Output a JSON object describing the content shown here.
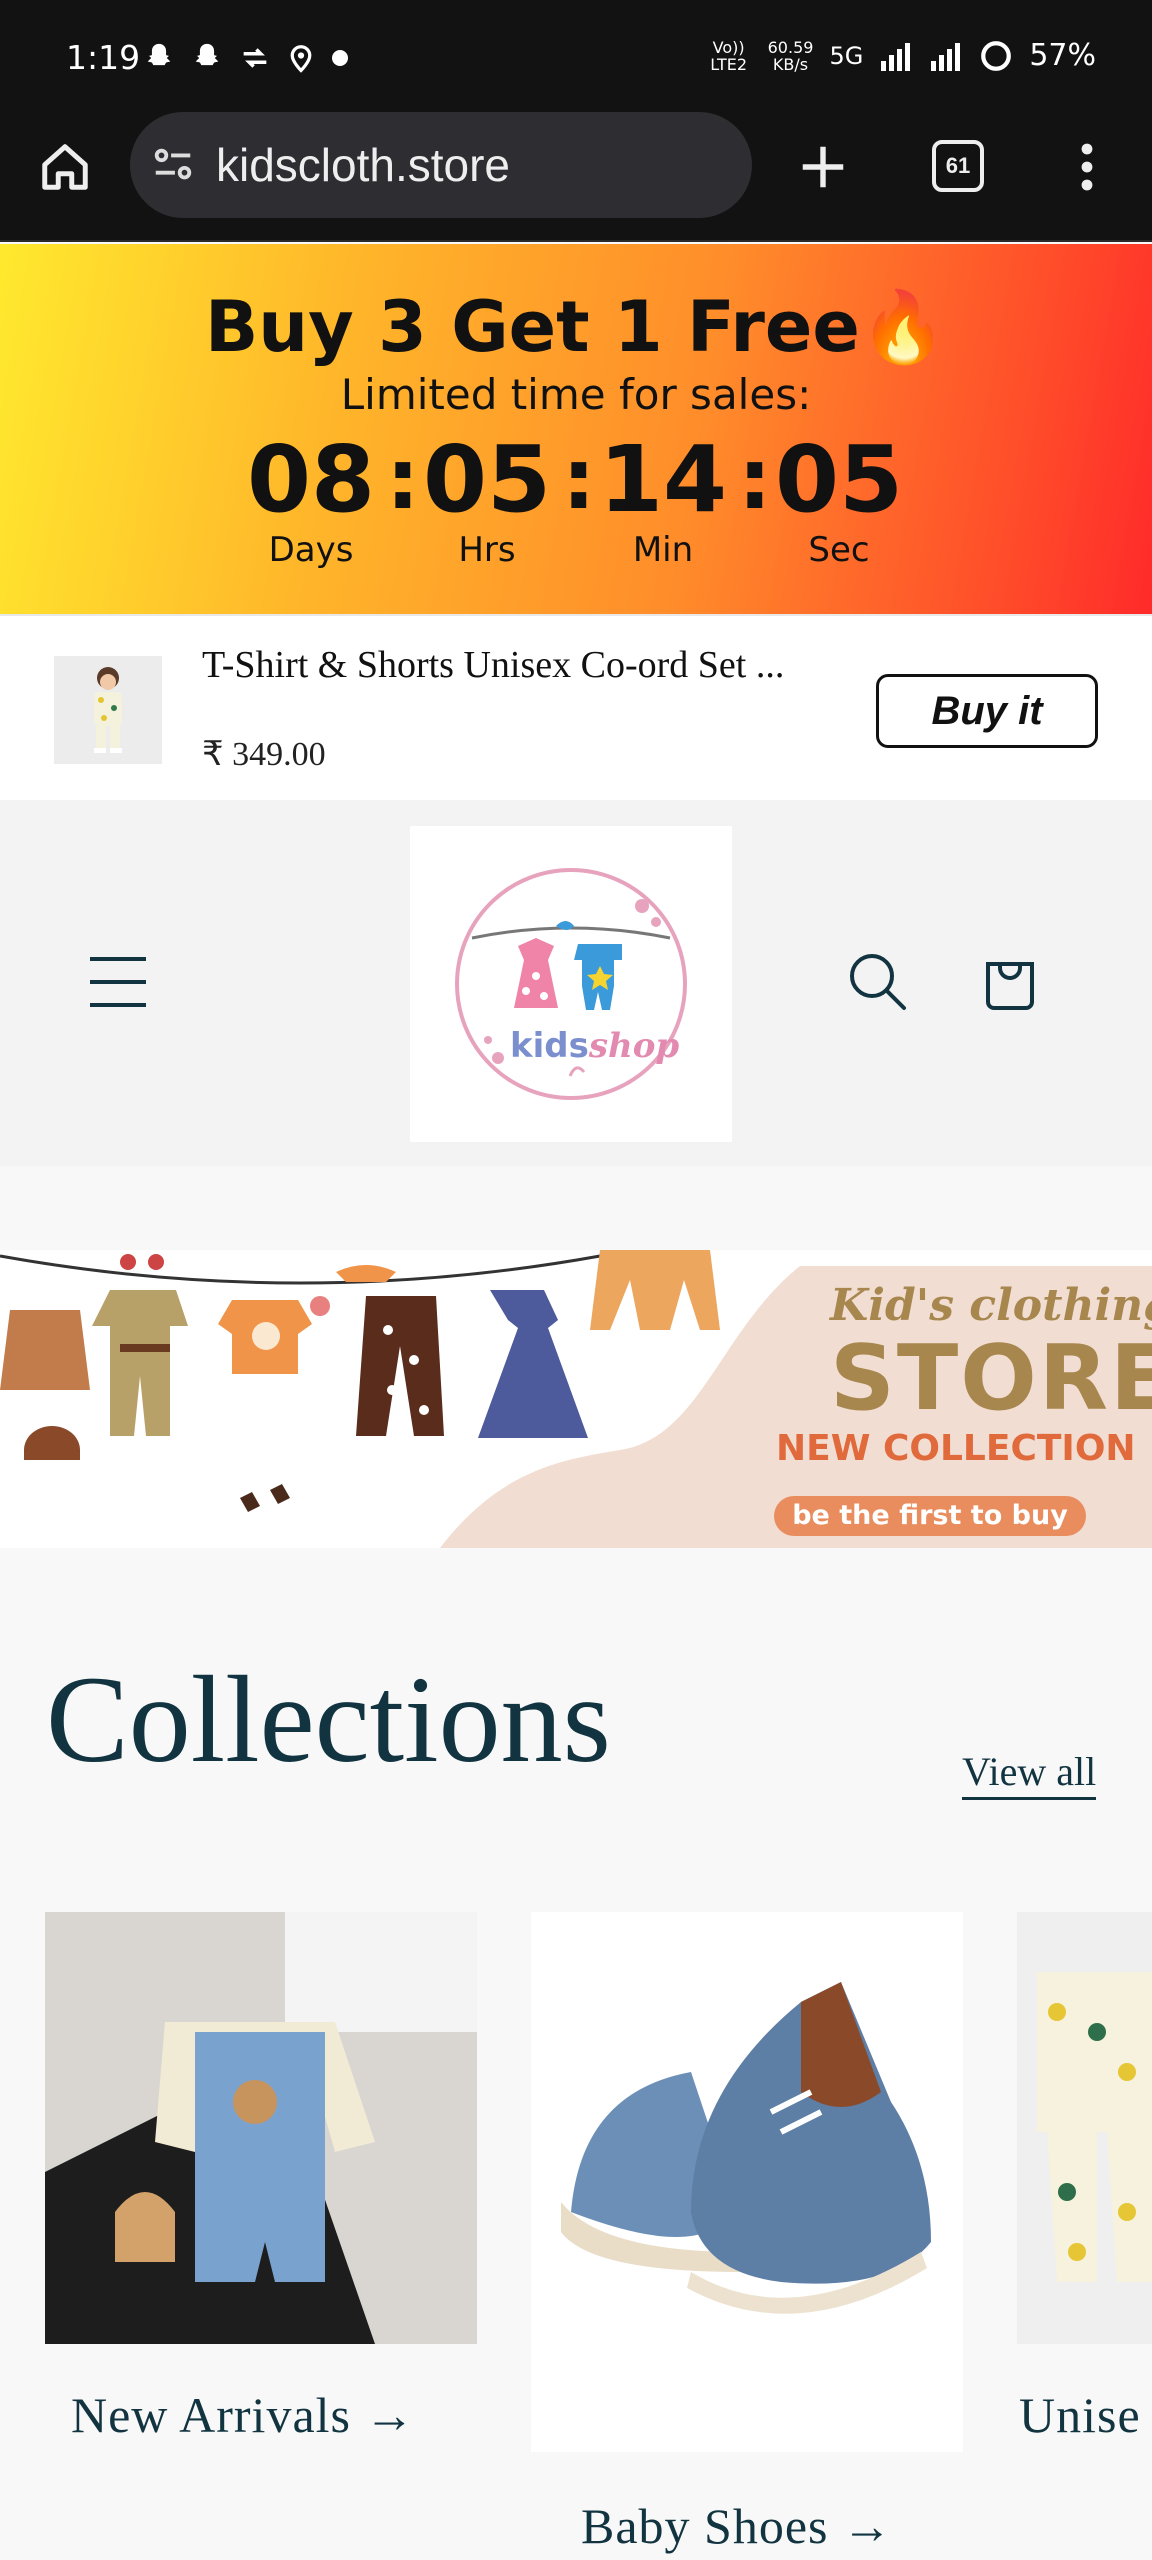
{
  "status_bar": {
    "time": "1:19",
    "network_label_1": "Vo)) LTE2",
    "speed_value": "60.59",
    "speed_unit": "KB/s",
    "network_type": "5G",
    "battery": "57%",
    "icons": [
      "snapchat-icon",
      "snapchat-icon",
      "sync-icon",
      "location-icon",
      "dot-icon",
      "signal-icon",
      "signal-icon",
      "battery-ring-icon"
    ]
  },
  "browser": {
    "url": "kidscloth.store",
    "tab_count": "61"
  },
  "promo": {
    "title": "Buy 3 Get 1 Free",
    "emoji": "🔥",
    "subtitle": "Limited time for sales:",
    "countdown": [
      {
        "value": "08",
        "label": "Days"
      },
      {
        "value": "05",
        "label": "Hrs"
      },
      {
        "value": "14",
        "label": "Min"
      },
      {
        "value": "05",
        "label": "Sec"
      }
    ],
    "colon": ":"
  },
  "sticky_product": {
    "title": "T-Shirt & Shorts Unisex Co-ord Set ...",
    "price": "₹ 349.00",
    "button": "Buy it"
  },
  "logo": {
    "word1": "kids",
    "word2": "shop"
  },
  "banner": {
    "script_line": "Kid's clothing",
    "store": "STORE",
    "new_collection": "NEW COLLECTION",
    "cta": "be the first to buy"
  },
  "collections": {
    "title": "Collections",
    "view_all": "View all",
    "items": [
      {
        "label": "New Arrivals",
        "arrow": "→"
      },
      {
        "label": "Baby Shoes",
        "arrow": "→"
      },
      {
        "label": "Unise"
      }
    ]
  },
  "colors": {
    "brand_navy": "#123441",
    "promo_start": "#ffe92e",
    "promo_end": "#ff2a2a"
  }
}
